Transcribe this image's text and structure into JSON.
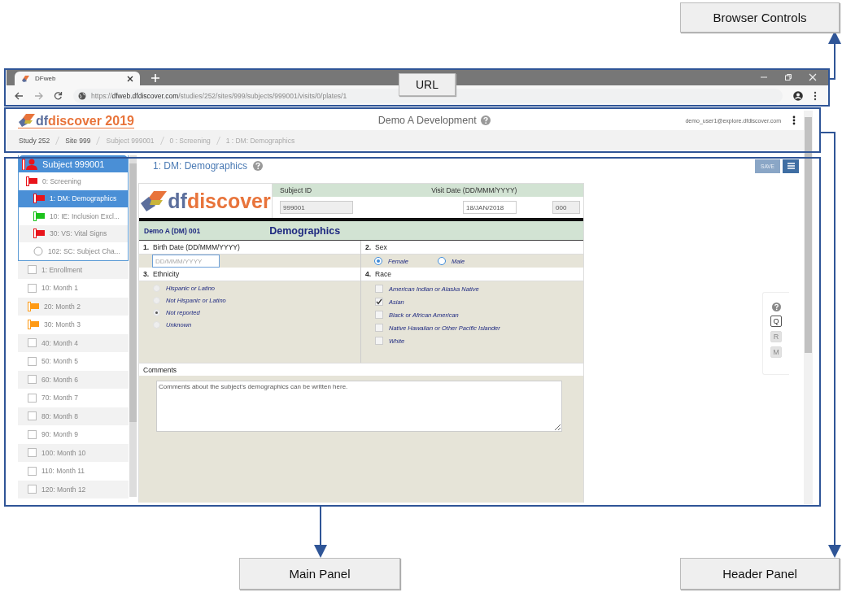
{
  "callouts": [
    {
      "label": "Browser Controls"
    },
    {
      "label": "URL"
    },
    {
      "label": "Main Panel"
    },
    {
      "label": "Header Panel"
    }
  ],
  "browser": {
    "tab_title": "DFweb",
    "url": "https://**dfweb.dfdiscover.com**/studies/252/sites/999/subjects/999001/visits/0/plates/1"
  },
  "header": {
    "logo_prefix": "df",
    "logo_name": "discover 2019",
    "study_title": "Demo A Development",
    "user": "demo_user1@explore.dfdiscover.com",
    "breadcrumbs": [
      {
        "label": "Study 252",
        "link": true
      },
      {
        "label": "Site 999",
        "link": true
      },
      {
        "label": "Subject 999001",
        "link": false
      },
      {
        "label": "0 : Screening",
        "link": false
      },
      {
        "label": "1 : DM: Demographics",
        "link": false
      }
    ]
  },
  "sidebar": {
    "subject": {
      "label": "Subject 999001",
      "color": "#e8141b"
    },
    "open_visits": [
      {
        "label": "0: Screening",
        "kind": "flag",
        "color": "#e8141b",
        "selected": false,
        "children": [
          {
            "label": "1: DM: Demographics",
            "kind": "flag",
            "color": "#e8141b",
            "selected": true
          },
          {
            "label": "10: IE: Inclusion Excl...",
            "kind": "flag",
            "color": "#1cc21c",
            "selected": false
          },
          {
            "label": "30: VS: Vital Signs",
            "kind": "flag",
            "color": "#e8141b",
            "selected": false
          },
          {
            "label": "102: SC: Subject Cha...",
            "kind": "circle",
            "selected": false
          }
        ]
      }
    ],
    "visits": [
      {
        "label": "1: Enrollment",
        "kind": "box",
        "selected": false
      },
      {
        "label": "10: Month 1",
        "kind": "box",
        "selected": false
      },
      {
        "label": "20: Month 2",
        "kind": "flag",
        "color": "#ff9a14",
        "selected": false
      },
      {
        "label": "30: Month 3",
        "kind": "flag",
        "color": "#ff9a14",
        "selected": false
      },
      {
        "label": "40: Month 4",
        "kind": "box",
        "selected": false
      },
      {
        "label": "50: Month 5",
        "kind": "box",
        "selected": false
      },
      {
        "label": "60: Month 6",
        "kind": "box",
        "selected": false
      },
      {
        "label": "70: Month 7",
        "kind": "box",
        "selected": false
      },
      {
        "label": "80: Month 8",
        "kind": "box",
        "selected": false
      },
      {
        "label": "90: Month 9",
        "kind": "box",
        "selected": false
      },
      {
        "label": "100: Month 10",
        "kind": "box",
        "selected": false
      },
      {
        "label": "110: Month 11",
        "kind": "box",
        "selected": false
      },
      {
        "label": "120: Month 12",
        "kind": "box",
        "selected": false
      }
    ]
  },
  "main": {
    "plate_title": "1: DM: Demographics",
    "save": "SAVE",
    "form": {
      "logo_prefix": "df",
      "logo_name": "discover",
      "subject_id": {
        "label": "Subject ID",
        "value": "999001"
      },
      "visit_date": {
        "label": "Visit Date (DD/MMM/YYYY)",
        "value": "18/JAN/2018"
      },
      "sequence": {
        "value": "000"
      },
      "form_code": "Demo A (DM) 001",
      "form_title": "Demographics",
      "questions": [
        {
          "number": "1.",
          "label": "Birth Date (DD/MMM/YYYY)",
          "kind": "date",
          "placeholder": "DD/MMM/YYYY"
        },
        {
          "number": "2.",
          "label": "Sex",
          "kind": "radio_row",
          "options": [
            {
              "label": "Female",
              "selected": true
            },
            {
              "label": "Male",
              "selected": false
            }
          ]
        },
        {
          "number": "3.",
          "label": "Ethnicity",
          "kind": "radio_list",
          "options": [
            {
              "label": "Hispanic or Latino",
              "selected": false
            },
            {
              "label": "Not Hispanic or Latino",
              "selected": false
            },
            {
              "label": "Not reported",
              "selected": true
            },
            {
              "label": "Unknown",
              "selected": false
            }
          ]
        },
        {
          "number": "4.",
          "label": "Race",
          "kind": "checkbox_list",
          "options": [
            {
              "label": "American Indian or Alaska Native",
              "checked": false
            },
            {
              "label": "Asian",
              "checked": true
            },
            {
              "label": "Black or African American",
              "checked": false
            },
            {
              "label": "Native Hawaiian or Other Pacific Islander",
              "checked": false
            },
            {
              "label": "White",
              "checked": false
            }
          ]
        }
      ],
      "comments": {
        "label": "Comments",
        "value": "Comments about the subject's demographics can be written here."
      }
    },
    "tools": [
      {
        "label": "Q",
        "disabled": false
      },
      {
        "label": "R",
        "disabled": true
      },
      {
        "label": "M",
        "disabled": true
      }
    ]
  }
}
